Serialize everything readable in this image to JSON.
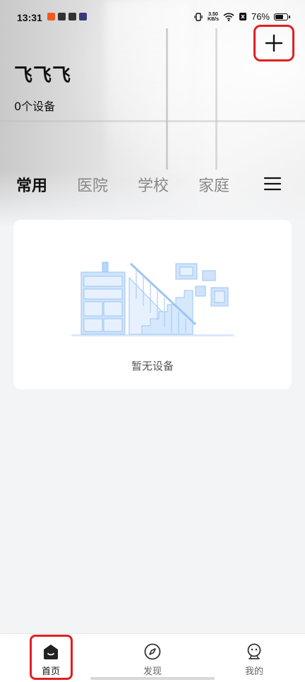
{
  "status_bar": {
    "time": "13:31",
    "net_speed_value": "3.50",
    "net_speed_unit": "KB/s",
    "battery_text": "76%",
    "battery_level": 0.76
  },
  "header": {
    "home_name": "飞飞飞",
    "device_count": "0个设备",
    "add_icon": "plus-icon"
  },
  "tabs": [
    {
      "label": "常用",
      "active": true
    },
    {
      "label": "医院",
      "active": false
    },
    {
      "label": "学校",
      "active": false
    },
    {
      "label": "家庭",
      "active": false
    }
  ],
  "empty_state": {
    "text": "暂无设备"
  },
  "bottom_nav": [
    {
      "label": "首页",
      "icon": "home-icon",
      "active": true
    },
    {
      "label": "发现",
      "icon": "compass-icon",
      "active": false
    },
    {
      "label": "我的",
      "icon": "profile-icon",
      "active": false
    }
  ],
  "colors": {
    "highlight": "#e02020",
    "illustration": "#cfe3fb"
  }
}
